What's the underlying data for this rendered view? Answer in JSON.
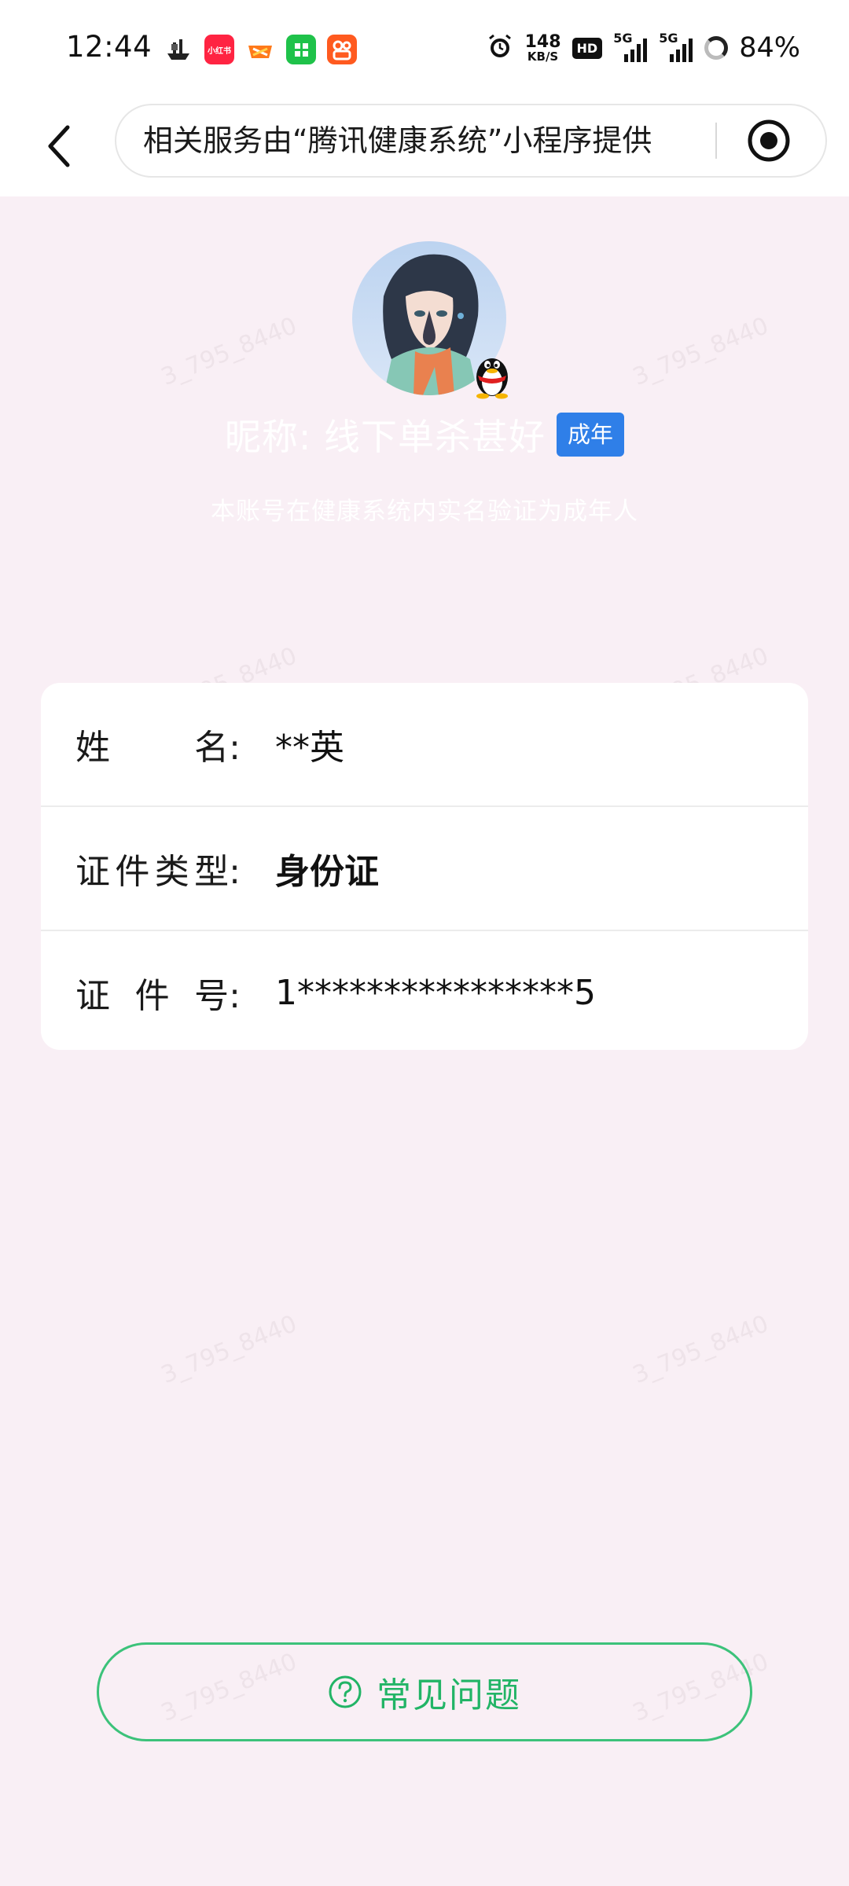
{
  "status_bar": {
    "time": "12:44",
    "net_speed_value": "148",
    "net_speed_unit": "KB/S",
    "hd_label": "HD",
    "signal1_label": "5G",
    "signal2_label": "5G",
    "battery_text": "84%",
    "app_icons": [
      "ship-app-icon",
      "xiaohongshu-app-icon",
      "game-app-icon",
      "green-app-icon",
      "kuaishou-app-icon"
    ],
    "xiaohongshu_label": "小红书"
  },
  "nav": {
    "url_text": "相关服务由“腾讯健康系统”小程序提供"
  },
  "profile": {
    "nickname": "昵称: 线下单杀甚好",
    "badge": "成年",
    "verify_note": "本账号在健康系统内实名验证为成年人"
  },
  "info": {
    "rows": [
      {
        "label_chars": [
          "姓",
          "名:"
        ],
        "value": "**英"
      },
      {
        "label_chars": [
          "证",
          "件",
          "类",
          "型:"
        ],
        "value": "身份证"
      },
      {
        "label_chars": [
          "证",
          "件",
          "号:"
        ],
        "value": "1****************5"
      }
    ]
  },
  "faq": {
    "label": "常见问题"
  },
  "watermark_text": "3_795_8440",
  "colors": {
    "page_bg": "#f9eff5",
    "accent_green": "#22b466",
    "badge_blue": "#2f7fe8"
  }
}
